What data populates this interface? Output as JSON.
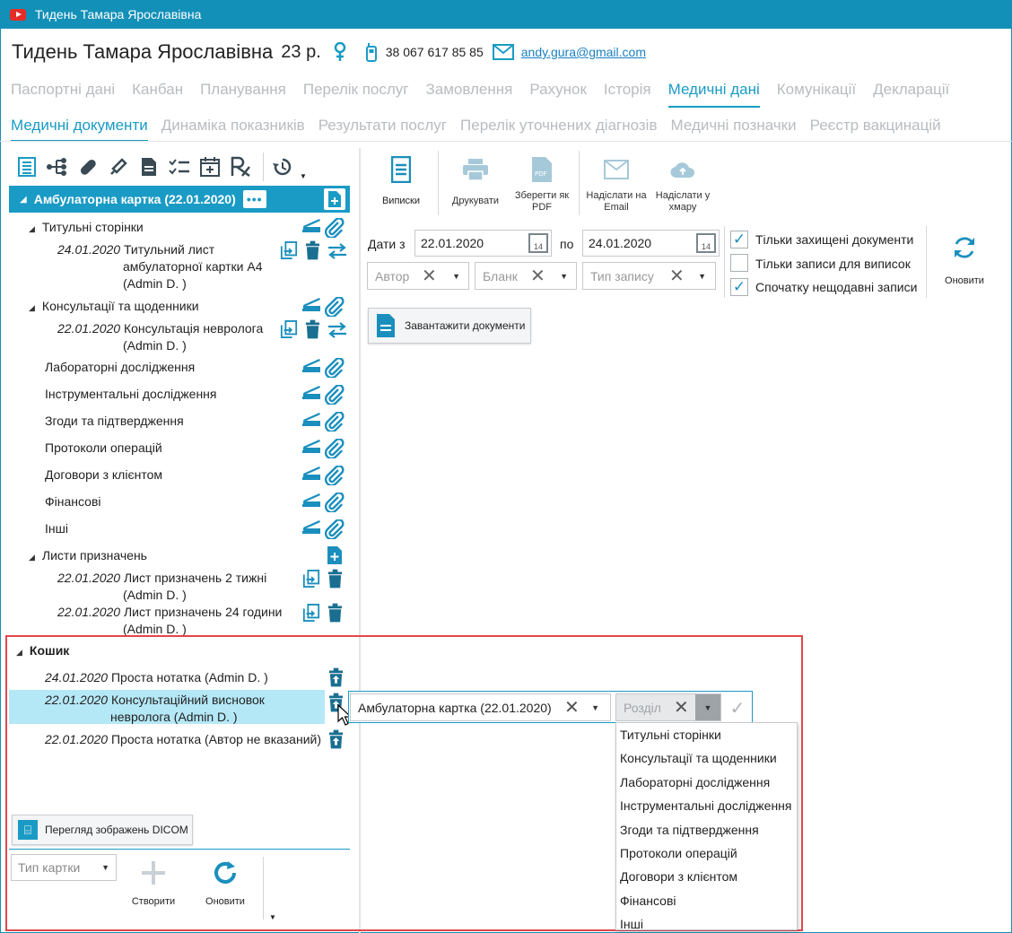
{
  "window": {
    "title": "Тидень Тамара Ярославівна"
  },
  "patient": {
    "name": "Тидень Тамара Ярославівна",
    "age": "23 р.",
    "phone": "38 067 617 85 85",
    "email": "andy.gura@gmail.com"
  },
  "tabs_main": [
    "Паспортні дані",
    "Канбан",
    "Планування",
    "Перелік послуг",
    "Замовлення",
    "Рахунок",
    "Історія",
    "Медичні дані",
    "Комунікації",
    "Декларації"
  ],
  "tabs_main_active": 7,
  "tabs_sub": [
    "Медичні документи",
    "Динаміка показників",
    "Результати послуг",
    "Перелік уточнених діагнозів",
    "Медичні позначки",
    "Реєстр вакцинацій"
  ],
  "card": {
    "header": "Амбулаторна картка (22.01.2020)",
    "menu": "•••"
  },
  "tree": {
    "s1": {
      "label": "Титульні сторінки",
      "date": "24.01.2020",
      "doc1": "Титульний лист",
      "doc2": "амбулаторної картки А4",
      "doc3": "(Admin D. )"
    },
    "s2": {
      "label": "Консультації та щоденники",
      "date": "22.01.2020",
      "doc1": "Консультація невролога",
      "doc2": "(Admin D. )"
    },
    "s3": "Лабораторні дослідження",
    "s4": "Інструментальні дослідження",
    "s5": "Згоди та підтвердження",
    "s6": "Протоколи операцій",
    "s7": "Договори з клієнтом",
    "s8": "Фінансові",
    "s9": "Інші",
    "s10": {
      "label": "Листи призначень",
      "d1date": "22.01.2020",
      "d1a": "Лист призначень 2 тижні",
      "d1b": "(Admin D. )",
      "d2date": "22.01.2020",
      "d2a": "Лист призначень 24 години",
      "d2b": "(Admin D. )"
    }
  },
  "basket": {
    "label": "Кошик",
    "i1date": "24.01.2020",
    "i1": "Проста нотатка (Admin D. )",
    "i2date": "22.01.2020",
    "i2a": "Консультаційний висновок",
    "i2b": "невролога (Admin D. )",
    "i3date": "22.01.2020",
    "i3": "Проста нотатка (Автор не вказаний)"
  },
  "dicom_button": "Перегляд зображень DICOM",
  "bottom": {
    "card_type": "Тип картки",
    "create": "Створити",
    "refresh": "Оновити"
  },
  "right_toolbar": {
    "extracts": "Виписки",
    "print": "Друкувати",
    "save_pdf_1": "Зберегти як",
    "save_pdf_2": "PDF",
    "send_email_1": "Надіслати на",
    "send_email_2": "Email",
    "send_cloud_1": "Надіслати у",
    "send_cloud_2": "хмару"
  },
  "filters": {
    "dates_from_label": "Дати з",
    "date_from": "22.01.2020",
    "to_label": "по",
    "date_to": "24.01.2020",
    "cal_day": "14",
    "author_ph": "Автор",
    "form_ph": "Бланк",
    "record_type_ph": "Тип запису",
    "only_protected": "Тільки захищені документи",
    "only_protected_checked": true,
    "only_extracts": "Тільки записи для виписок",
    "only_extracts_checked": false,
    "recent_first": "Спочатку нещодавні записи",
    "recent_first_checked": true,
    "refresh": "Оновити"
  },
  "upload_button": "Завантажити документи",
  "restore": {
    "card_value": "Амбулаторна картка (22.01.2020)",
    "section_ph": "Розділ",
    "options": [
      "Титульні сторінки",
      "Консультації та щоденники",
      "Лабораторні дослідження",
      "Інструментальні дослідження",
      "Згоди та підтвердження",
      "Протоколи операцій",
      "Договори з клієнтом",
      "Фінансові",
      "Інші"
    ]
  },
  "colors": {
    "accent": "#1a9bc5",
    "title_bar": "#1390b8",
    "basket_border": "#e0474c",
    "selection": "#b5e8f7"
  }
}
